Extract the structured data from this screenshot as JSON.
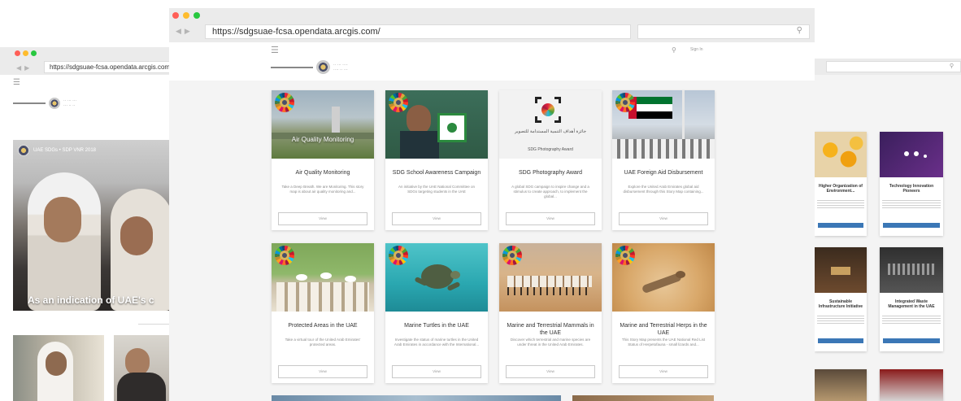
{
  "colors": {
    "close_dot": "#ff5f57",
    "minimize_dot": "#febc2e",
    "zoom_dot": "#28c840",
    "button_blue": "#3b77b6",
    "chrome_gray": "#ebebeb"
  },
  "left_window": {
    "url": "https://sdgsuae-fcsa.opendata.arcgis.com/",
    "hero_tag": "UAE SDGs • SDP VNR 2018",
    "hero_caption": "As an indication of UAE's c"
  },
  "main_window": {
    "url": "https://sdgsuae-fcsa.opendata.arcgis.com/",
    "header": {
      "menu_icon": "hamburger-icon",
      "search_icon": "search-icon",
      "signin_label": "Sign In"
    },
    "cards": [
      {
        "title": "Air Quality Monitoring",
        "image_label": "Air Quality Monitoring",
        "description": "Take a Deep Breath. We are Monitoring. This story map is about air quality monitoring and...",
        "button": "View"
      },
      {
        "title": "SDG School Awareness Campaign",
        "description": "An initiative by the UAE National Committee on SDGs targeting students in the UAE",
        "button": "View"
      },
      {
        "title": "SDG Photography Award",
        "image_ar": "جائزة أهداف التنمية المستدامة للتصوير",
        "image_en": "SDG Photography Award",
        "description": "A global SDG campaign to inspire change and a stimulus to create approach, to implement the global...",
        "button": "View"
      },
      {
        "title": "UAE Foreign Aid Disbursement",
        "description": "Explore the United Arab Emirates global aid disbursement through this Story Map containing...",
        "button": "View"
      },
      {
        "title": "Protected Areas in the UAE",
        "description": "Take a virtual tour of the United Arab Emirates' protected areas.",
        "button": "View"
      },
      {
        "title": "Marine Turtles in the UAE",
        "description": "Investigate the status of marine turtles in the United Arab Emirates in accordance with the International...",
        "button": "View"
      },
      {
        "title": "Marine and Terrestrial Mammals in the UAE",
        "description": "Discover which terrestrial and marine species are under threat in the United Arab Emirates.",
        "button": "View"
      },
      {
        "title": "Marine and Terrestrial Herps in the UAE",
        "description": "This Story Map presents the UAE National Red List Status of Herpetofauna - small lizards and...",
        "button": "View"
      }
    ]
  },
  "right_window": {
    "cards": [
      {
        "title": "Higher Organization of Environment..."
      },
      {
        "title": "Technology Innovation Pioneers"
      },
      {
        "title": "Sustainable Infrastructure Initiative"
      },
      {
        "title": "Integrated Waste Management in the UAE"
      }
    ]
  }
}
